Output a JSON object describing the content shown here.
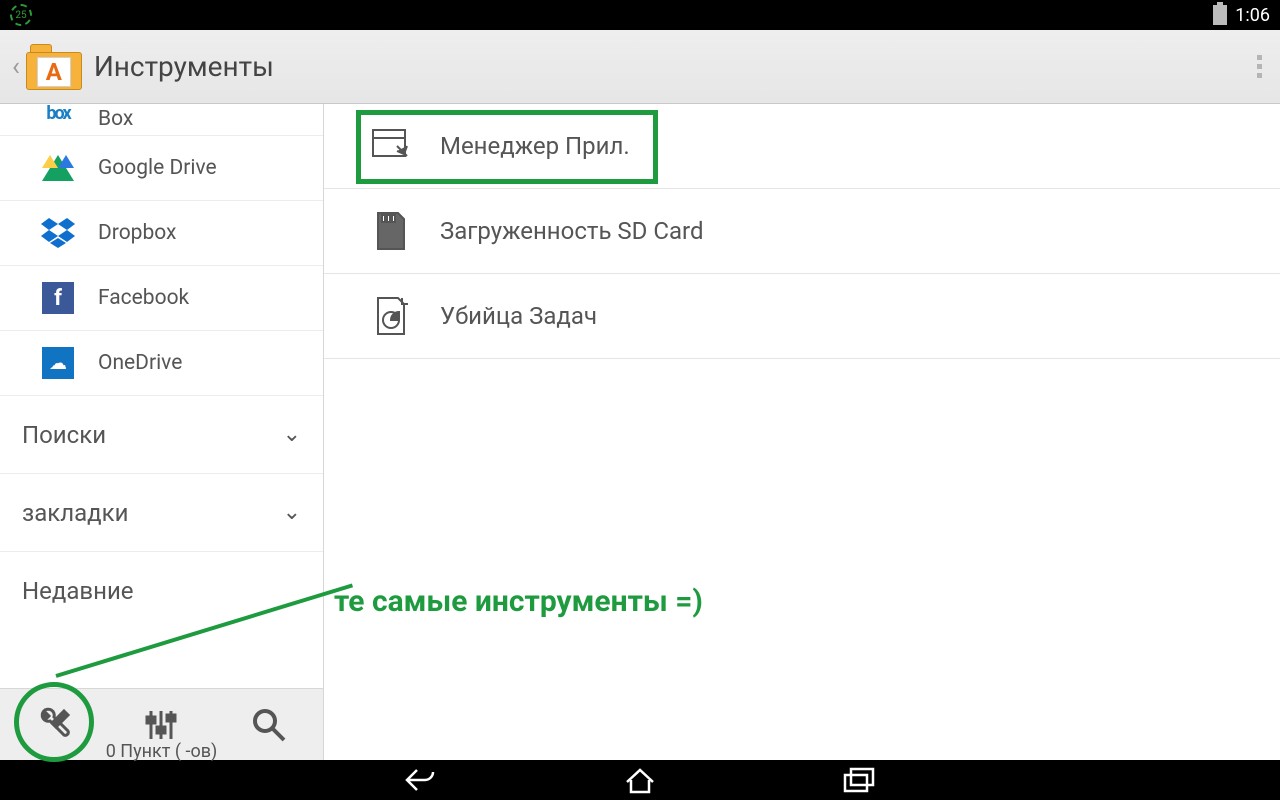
{
  "statusbar": {
    "indicator": "25",
    "time": "1:06"
  },
  "appbar": {
    "title": "Инструменты"
  },
  "sidebar": {
    "items": [
      {
        "label": "Box"
      },
      {
        "label": "Google Drive"
      },
      {
        "label": "Dropbox"
      },
      {
        "label": "Facebook"
      },
      {
        "label": "OneDrive"
      }
    ],
    "sections": [
      {
        "label": "Поиски"
      },
      {
        "label": "закладки"
      },
      {
        "label": "Недавние"
      }
    ],
    "status": "0 Пункт ( -ов)"
  },
  "main": {
    "tools": [
      {
        "label": "Менеджер Прил."
      },
      {
        "label": "Загруженность SD Card"
      },
      {
        "label": "Убийца Задач"
      }
    ]
  },
  "annotation": "те самые инструменты =)"
}
